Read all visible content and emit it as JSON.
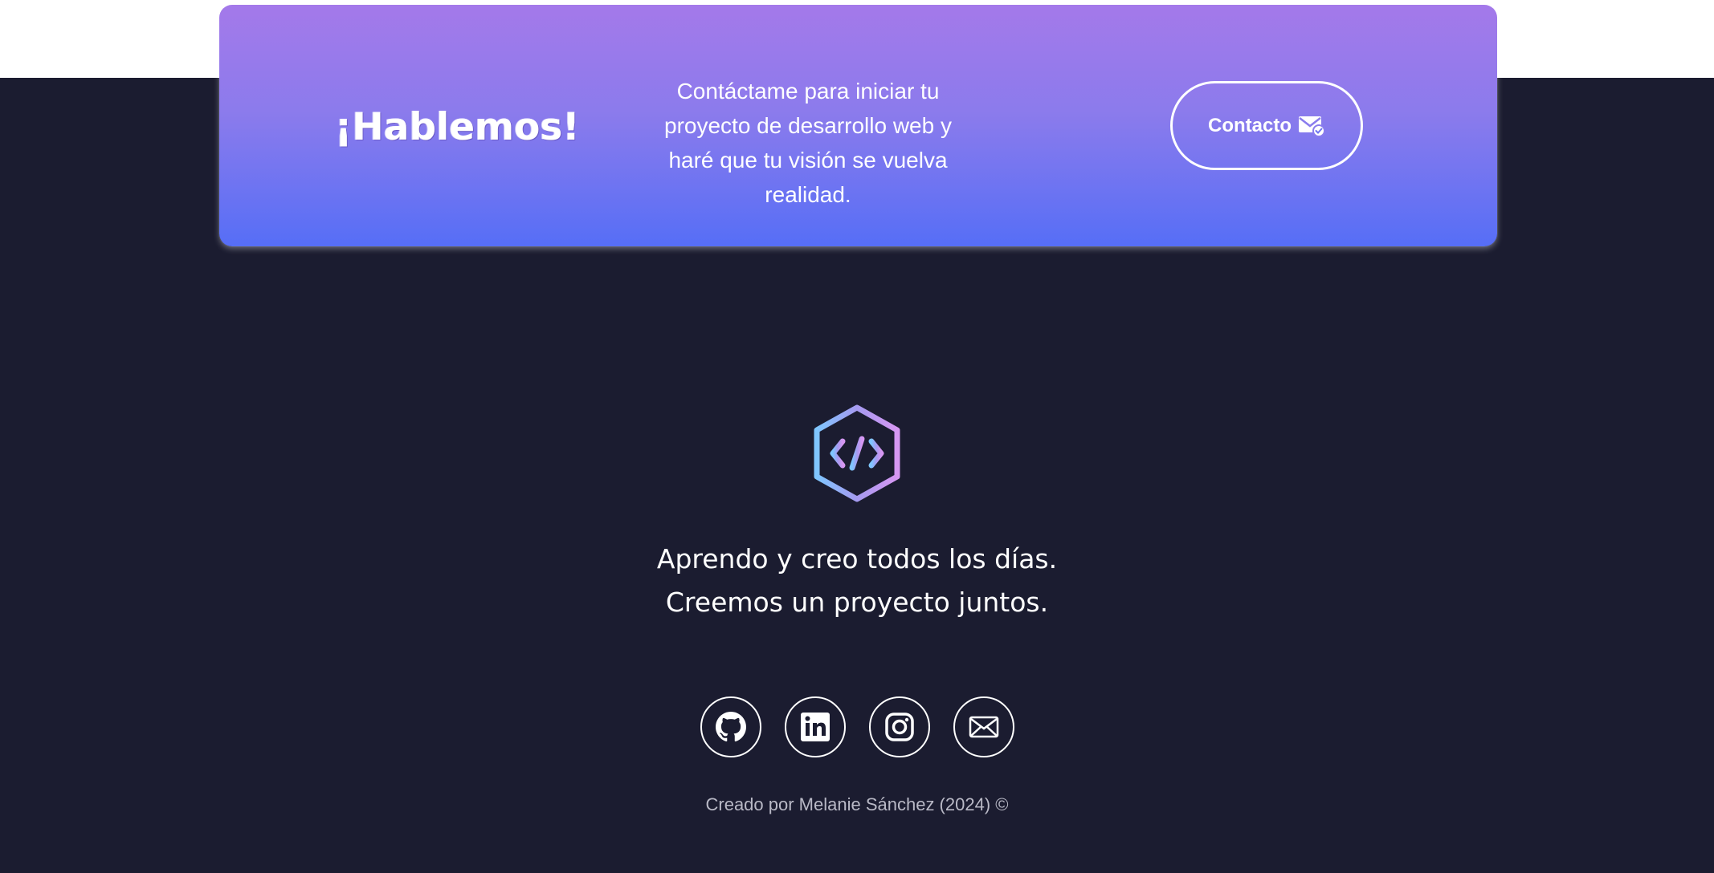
{
  "cta": {
    "title": "¡Hablemos!",
    "text": "Contáctame para iniciar tu proyecto de desarrollo web y haré que tu visión se vuelva realidad.",
    "button_label": "Contacto",
    "button_icon": "mail-check-icon"
  },
  "footer": {
    "logo_icon": "code-hexagon-logo-icon",
    "tagline_line1": "Aprendo y creo todos los días.",
    "tagline_line2": "Creemos un proyecto juntos.",
    "socials": [
      {
        "icon": "github-icon"
      },
      {
        "icon": "linkedin-icon"
      },
      {
        "icon": "instagram-icon"
      },
      {
        "icon": "email-icon"
      }
    ],
    "credits": "Creado por Melanie Sánchez (2024) ©"
  },
  "colors": {
    "page_background": "#1b1c30",
    "card_gradient_top": "#a479ea",
    "card_gradient_bottom": "#566ef6",
    "text": "#ffffff",
    "muted_text": "#b9b9c6"
  }
}
